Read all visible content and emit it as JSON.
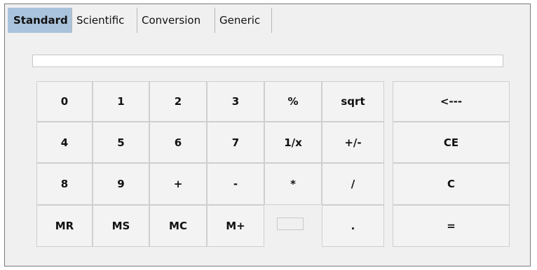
{
  "tabs": [
    {
      "label": "Standard",
      "active": true
    },
    {
      "label": "Scientific",
      "active": false
    },
    {
      "label": "Conversion",
      "active": false
    },
    {
      "label": "Generic",
      "active": false
    }
  ],
  "display": {
    "value": ""
  },
  "keys": {
    "k0": "0",
    "k1": "1",
    "k2": "2",
    "k3": "3",
    "percent": "%",
    "sqrt": "sqrt",
    "backspace": "<---",
    "k4": "4",
    "k5": "5",
    "k6": "6",
    "k7": "7",
    "reciprocal": "1/x",
    "negate": "+/-",
    "ce": "CE",
    "k8": "8",
    "k9": "9",
    "plus": "+",
    "minus": "-",
    "multiply": "*",
    "divide": "/",
    "clear": "C",
    "mr": "MR",
    "ms": "MS",
    "mc": "MC",
    "mplus": "M+",
    "decimal": ".",
    "equals": "="
  },
  "colors": {
    "active_tab": "#a9c3dc",
    "background": "#f0f0f0",
    "key_face": "#f3f3f3"
  }
}
